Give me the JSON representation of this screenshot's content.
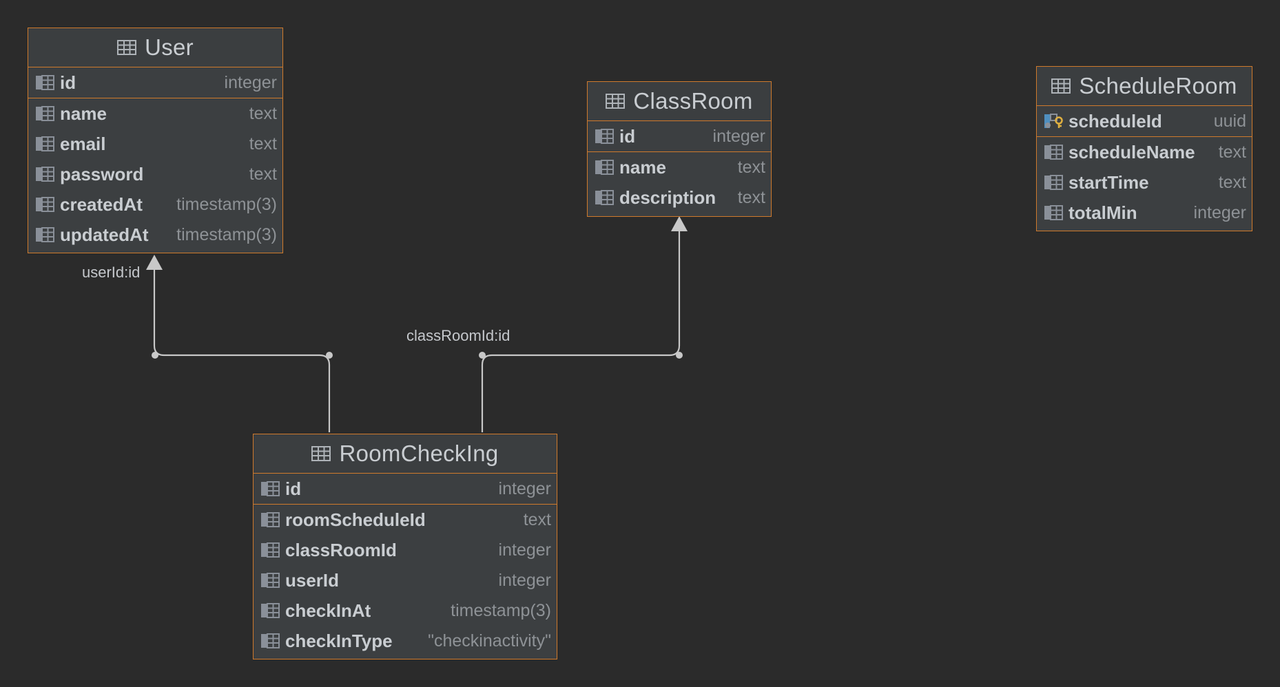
{
  "colors": {
    "background": "#2b2b2b",
    "entity_fill": "#3c3f41",
    "entity_border": "#d07a2c",
    "text": "#c9cdd1",
    "type_text": "#8e9296",
    "connector": "#c8c8c8"
  },
  "entities": {
    "user": {
      "title": "User",
      "columns": [
        {
          "name": "id",
          "type": "integer",
          "icon": "column-icon"
        },
        {
          "name": "name",
          "type": "text",
          "icon": "column-icon"
        },
        {
          "name": "email",
          "type": "text",
          "icon": "column-icon"
        },
        {
          "name": "password",
          "type": "text",
          "icon": "column-icon"
        },
        {
          "name": "createdAt",
          "type": "timestamp(3)",
          "icon": "column-icon"
        },
        {
          "name": "updatedAt",
          "type": "timestamp(3)",
          "icon": "column-icon"
        }
      ]
    },
    "classroom": {
      "title": "ClassRoom",
      "columns": [
        {
          "name": "id",
          "type": "integer",
          "icon": "column-icon"
        },
        {
          "name": "name",
          "type": "text",
          "icon": "column-icon"
        },
        {
          "name": "description",
          "type": "text",
          "icon": "column-icon"
        }
      ]
    },
    "scheduleroom": {
      "title": "ScheduleRoom",
      "columns": [
        {
          "name": "scheduleId",
          "type": "uuid",
          "icon": "primary-key-icon"
        },
        {
          "name": "scheduleName",
          "type": "text",
          "icon": "column-icon"
        },
        {
          "name": "startTime",
          "type": "text",
          "icon": "column-icon"
        },
        {
          "name": "totalMin",
          "type": "integer",
          "icon": "column-icon"
        }
      ]
    },
    "roomchecking": {
      "title": "RoomCheckIng",
      "columns": [
        {
          "name": "id",
          "type": "integer",
          "icon": "column-icon"
        },
        {
          "name": "roomScheduleId",
          "type": "text",
          "icon": "column-icon"
        },
        {
          "name": "classRoomId",
          "type": "integer",
          "icon": "column-icon"
        },
        {
          "name": "userId",
          "type": "integer",
          "icon": "column-icon"
        },
        {
          "name": "checkInAt",
          "type": "timestamp(3)",
          "icon": "column-icon"
        },
        {
          "name": "checkInType",
          "type": "\"checkinactivity\"",
          "icon": "column-icon"
        }
      ]
    }
  },
  "relations": [
    {
      "from": "RoomCheckIng",
      "to": "User",
      "label": "userId:id"
    },
    {
      "from": "RoomCheckIng",
      "to": "ClassRoom",
      "label": "classRoomId:id"
    }
  ]
}
